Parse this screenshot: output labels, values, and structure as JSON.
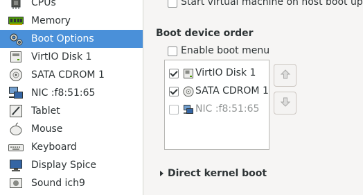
{
  "sidebar": {
    "items": [
      {
        "label": "CPUs",
        "icon": "cpu-icon"
      },
      {
        "label": "Memory",
        "icon": "memory-icon"
      },
      {
        "label": "Boot Options",
        "icon": "boot-options-icon",
        "selected": true
      },
      {
        "label": "VirtIO Disk 1",
        "icon": "disk-icon"
      },
      {
        "label": "SATA CDROM 1",
        "icon": "cdrom-icon"
      },
      {
        "label": "NIC :f8:51:65",
        "icon": "network-icon"
      },
      {
        "label": "Tablet",
        "icon": "tablet-icon"
      },
      {
        "label": "Mouse",
        "icon": "mouse-icon"
      },
      {
        "label": "Keyboard",
        "icon": "keyboard-icon"
      },
      {
        "label": "Display Spice",
        "icon": "display-icon"
      },
      {
        "label": "Sound ich9",
        "icon": "sound-icon"
      }
    ]
  },
  "main": {
    "autostart_label": "Start virtual machine on host boot up",
    "boot_order_title": "Boot device order",
    "enable_boot_menu_label": "Enable boot menu",
    "enable_boot_menu_checked": false,
    "boot_devices": [
      {
        "label": "VirtIO Disk 1",
        "checked": true,
        "enabled": true,
        "icon": "disk-icon"
      },
      {
        "label": "SATA CDROM 1",
        "checked": true,
        "enabled": true,
        "icon": "cdrom-icon"
      },
      {
        "label": "NIC :f8:51:65",
        "checked": false,
        "enabled": false,
        "icon": "network-icon"
      }
    ],
    "move_up_icon": "arrow-up-icon",
    "move_down_icon": "arrow-down-icon",
    "direct_kernel_boot_label": "Direct kernel boot"
  },
  "colors": {
    "selection": "#4a90d9",
    "pane_background": "#f6f5f4"
  }
}
